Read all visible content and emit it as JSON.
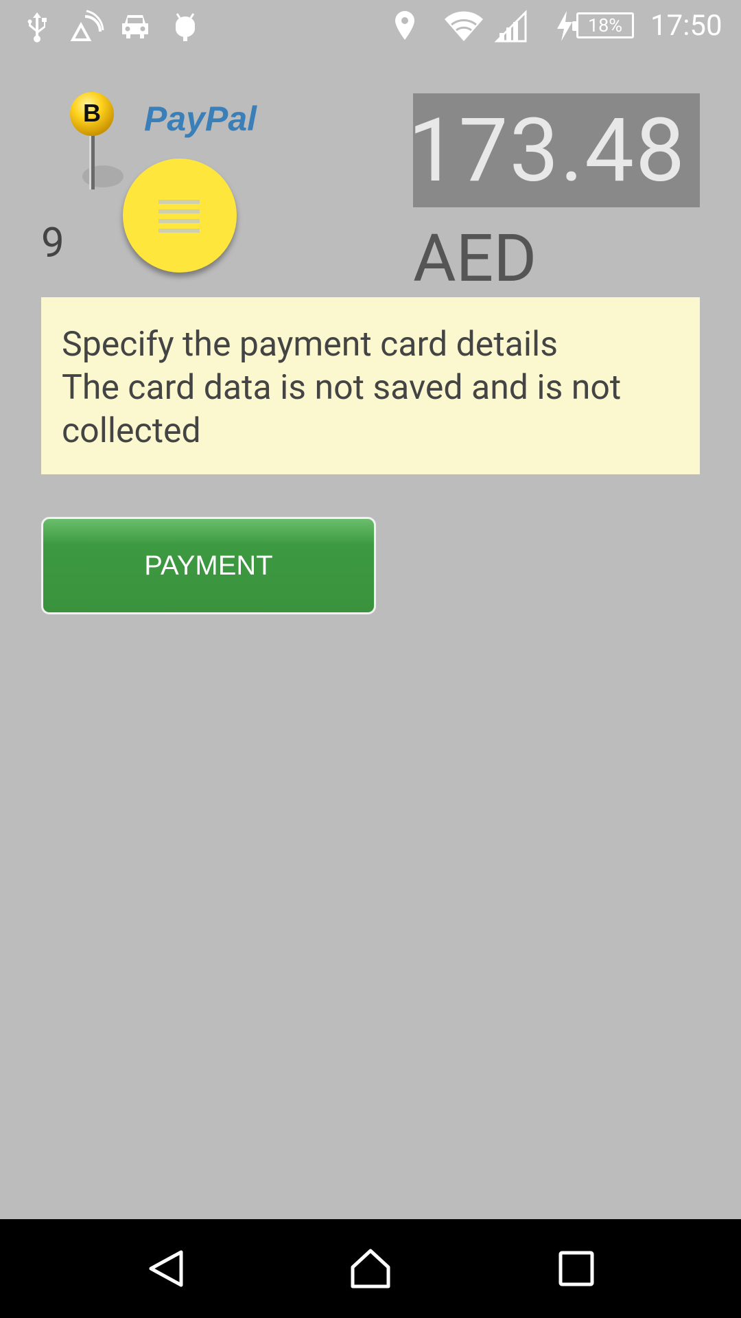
{
  "status_bar": {
    "icons_left": [
      "usb-icon",
      "wifi-tethering-icon",
      "car-icon",
      "android-debug-icon"
    ],
    "icons_right": [
      "location-icon",
      "wifi-icon",
      "signal-icon",
      "charging-icon"
    ],
    "battery": "18%",
    "time": "17:50"
  },
  "header": {
    "pin_letter": "B",
    "brand": "PayPal",
    "count": "9",
    "amount": "173.48",
    "currency": "AED"
  },
  "info": {
    "line1": "Specify the payment card details",
    "line2": "The card data is not saved and is not collected"
  },
  "actions": {
    "payment_label": "PAYMENT"
  },
  "nav_bar": {
    "buttons": [
      "back-icon",
      "home-icon",
      "recents-icon"
    ]
  },
  "colors": {
    "background": "#bcbcbc",
    "fab": "#ffe63c",
    "amount_box": "#898989",
    "info_panel": "#fbf8d0",
    "payment_button": "#3d9a41",
    "brand": "#3a7fb8"
  }
}
